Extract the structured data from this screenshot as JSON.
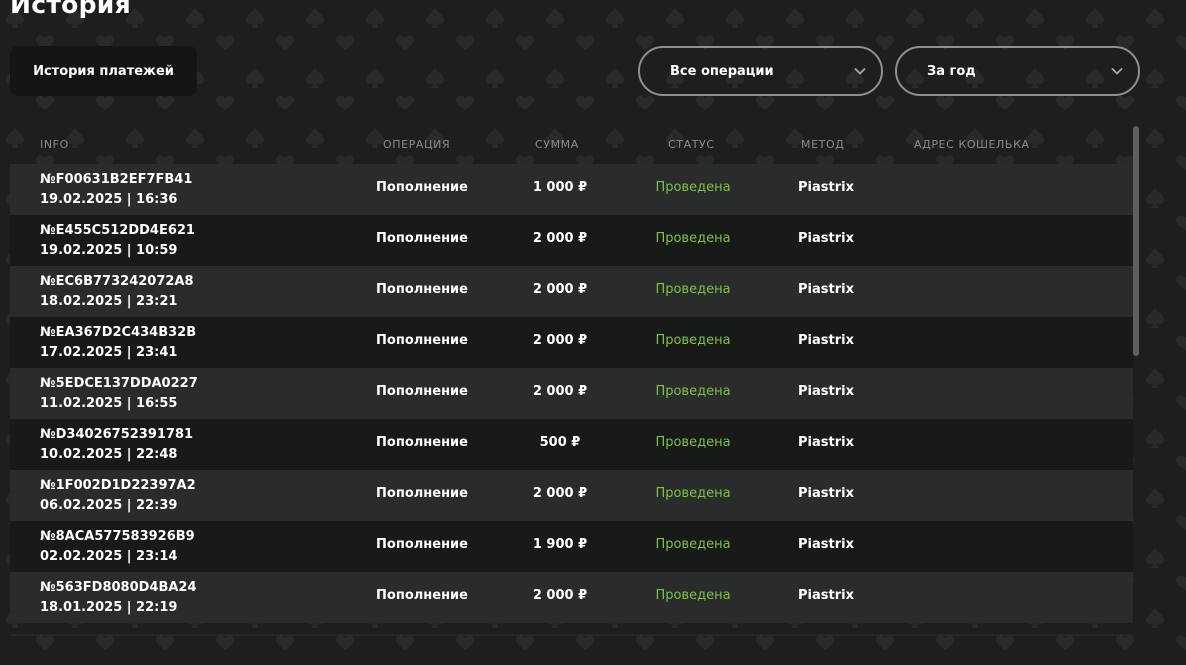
{
  "page": {
    "title": "История"
  },
  "tabs": {
    "payment_history": "История платежей"
  },
  "filters": {
    "operations": {
      "selected": "Все операции",
      "icon": "chevron-down-icon"
    },
    "period": {
      "selected": "За год",
      "icon": "chevron-down-icon"
    }
  },
  "table": {
    "columns": [
      "INFO",
      "ОПЕРАЦИЯ",
      "СУММА",
      "СТАТУС",
      "МЕТОД",
      "АДРЕС КОШЕЛЬКА"
    ],
    "rows": [
      {
        "id": "№F00631B2EF7FB41",
        "date": "19.02.2025 | 16:36",
        "operation": "Пополнение",
        "amount": "1 000 ₽",
        "status": "Проведена",
        "method": "Piastrix",
        "wallet": ""
      },
      {
        "id": "№E455C512DD4E621",
        "date": "19.02.2025 | 10:59",
        "operation": "Пополнение",
        "amount": "2 000 ₽",
        "status": "Проведена",
        "method": "Piastrix",
        "wallet": ""
      },
      {
        "id": "№EC6B773242072A8",
        "date": "18.02.2025 | 23:21",
        "operation": "Пополнение",
        "amount": "2 000 ₽",
        "status": "Проведена",
        "method": "Piastrix",
        "wallet": ""
      },
      {
        "id": "№EA367D2C434B32B",
        "date": "17.02.2025 | 23:41",
        "operation": "Пополнение",
        "amount": "2 000 ₽",
        "status": "Проведена",
        "method": "Piastrix",
        "wallet": ""
      },
      {
        "id": "№5EDCE137DDA0227",
        "date": "11.02.2025 | 16:55",
        "operation": "Пополнение",
        "amount": "2 000 ₽",
        "status": "Проведена",
        "method": "Piastrix",
        "wallet": ""
      },
      {
        "id": "№D34026752391781",
        "date": "10.02.2025 | 22:48",
        "operation": "Пополнение",
        "amount": "500 ₽",
        "status": "Проведена",
        "method": "Piastrix",
        "wallet": ""
      },
      {
        "id": "№1F002D1D22397A2",
        "date": "06.02.2025 | 22:39",
        "operation": "Пополнение",
        "amount": "2 000 ₽",
        "status": "Проведена",
        "method": "Piastrix",
        "wallet": ""
      },
      {
        "id": "№8ACA577583926B9",
        "date": "02.02.2025 | 23:14",
        "operation": "Пополнение",
        "amount": "1 900 ₽",
        "status": "Проведена",
        "method": "Piastrix",
        "wallet": ""
      },
      {
        "id": "№563FD8080D4BA24",
        "date": "18.01.2025 | 22:19",
        "operation": "Пополнение",
        "amount": "2 000 ₽",
        "status": "Проведена",
        "method": "Piastrix",
        "wallet": ""
      }
    ]
  },
  "colors": {
    "background": "#1d1f1e",
    "row_light": "#2a2c2b",
    "row_dark": "#181a19",
    "status_success": "#7ec047",
    "header_text": "#8a8c8b"
  }
}
